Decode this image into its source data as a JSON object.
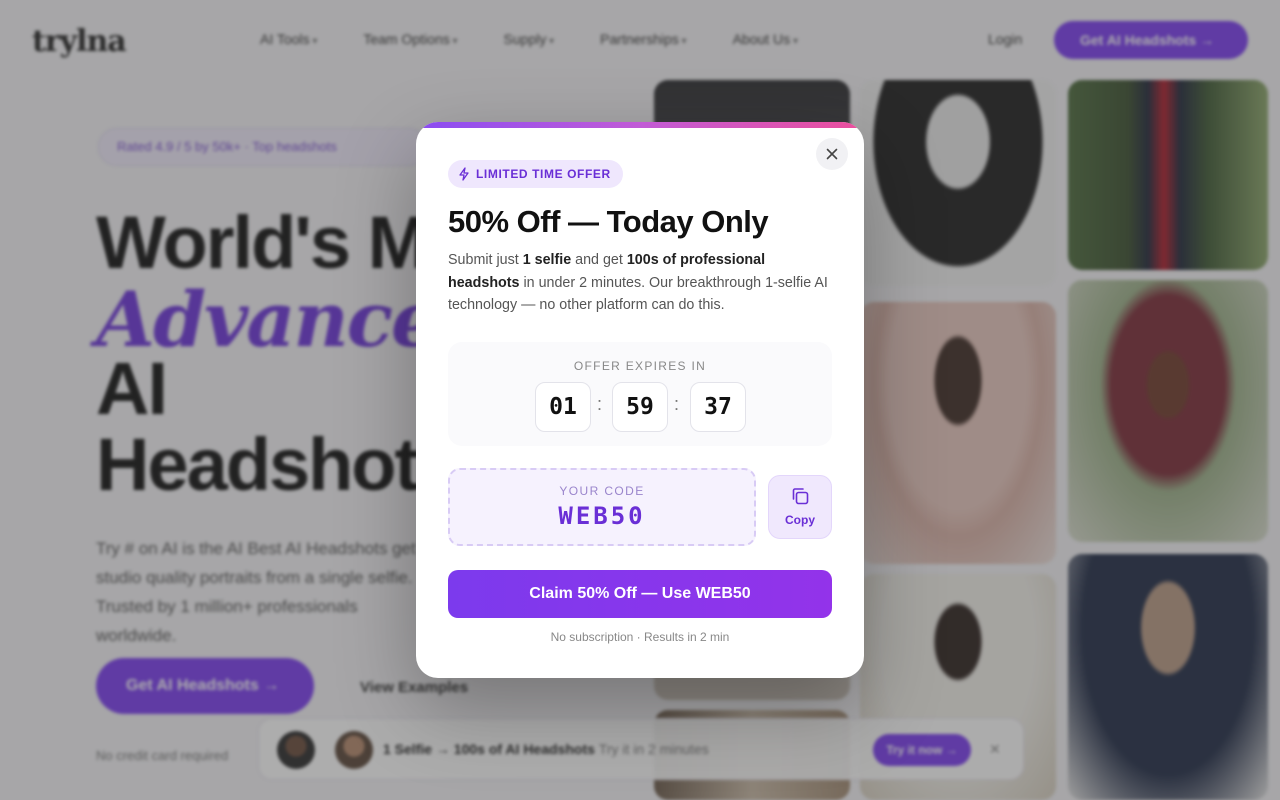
{
  "background": {
    "logo": "trylna",
    "nav": [
      "AI Tools",
      "Team Options",
      "Supply",
      "Partnerships",
      "About Us"
    ],
    "login": "Login",
    "nav_cta": "Get AI Headshots →",
    "pill": "Rated 4.9 / 5 by 50k+ · Top headshots",
    "hero_line1": "World's M",
    "hero_line2": "Advanced",
    "hero_line3": "AI",
    "hero_line4": "Headshot",
    "hero_paragraph": "Try # on AI is the AI Best AI Headshots get studio quality portraits from a single selfie. Trusted by 1 million+ professionals worldwide.",
    "hero_cta": "Get AI Headshots →",
    "hero_link": "View Examples",
    "hero_foot": "No credit card required",
    "toast_text": "1 Selfie → 100s of AI Headshots",
    "toast_sub": "Try it in 2 minutes",
    "toast_btn": "Try it now →",
    "toast_close": "✕"
  },
  "modal": {
    "badge": "LIMITED TIME OFFER",
    "title": "50% Off — Today Only",
    "desc_parts": {
      "p1": "Submit just ",
      "b1": "1 selfie",
      "p2": " and get ",
      "b2": "100s of professional headshots",
      "p3": " in under 2 minutes. Our breakthrough 1-selfie AI technology — no other platform can do this."
    },
    "timer_label": "OFFER EXPIRES IN",
    "timer": {
      "hours": "01",
      "minutes": "59",
      "seconds": "37",
      "separator": ":"
    },
    "code_label": "YOUR CODE",
    "code_value": "WEB50",
    "copy_label": "Copy",
    "claim_label": "Claim 50% Off — Use WEB50",
    "footnote": "No subscription · Results in 2 min"
  },
  "colors": {
    "accent": "#7c3aed",
    "accent_dark": "#6a2fd6",
    "badge_bg": "#efe7fd"
  }
}
